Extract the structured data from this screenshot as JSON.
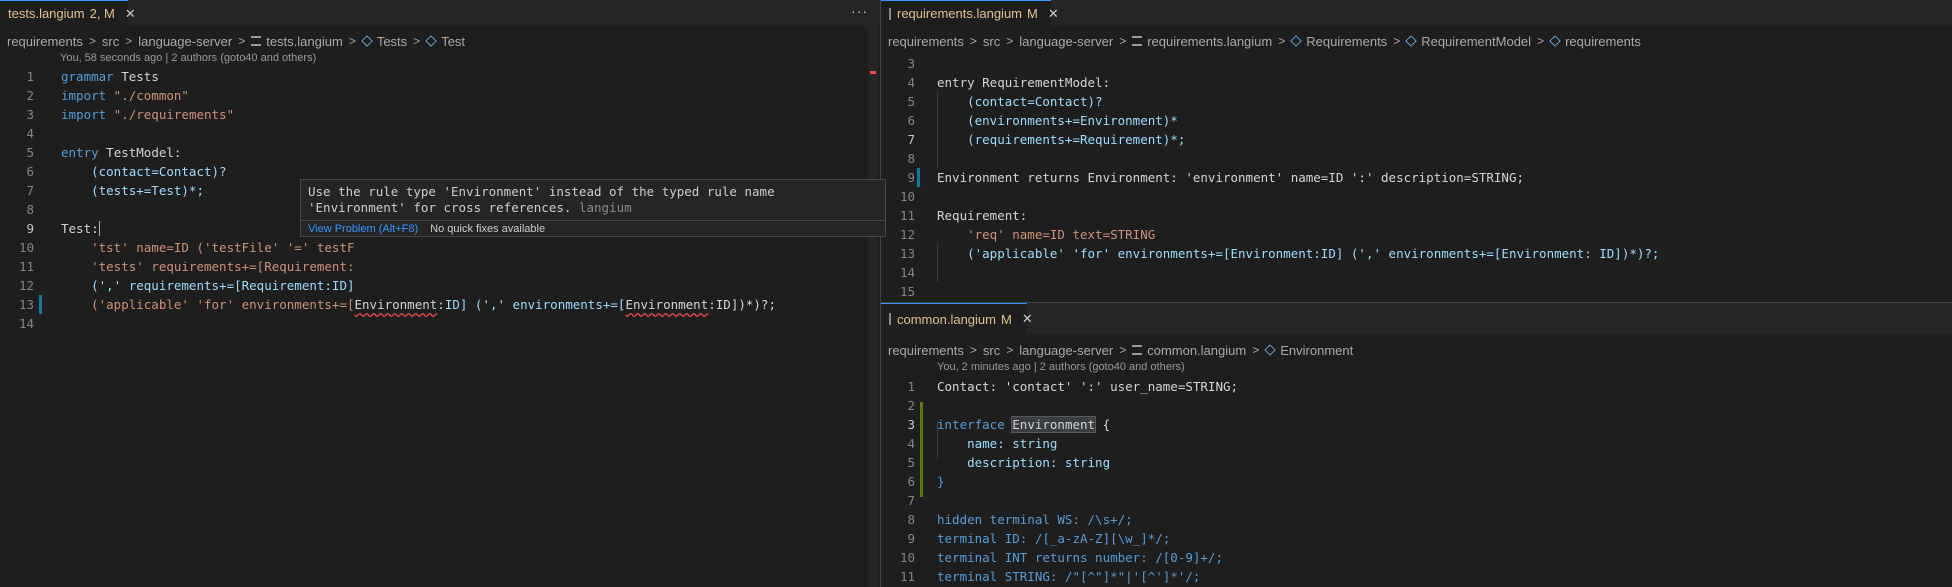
{
  "left": {
    "tab": {
      "name": "tests.langium",
      "status": "2, M"
    },
    "more_label": "···",
    "breadcrumb": [
      "requirements",
      "src",
      "language-server",
      "tests.langium",
      "Tests",
      "Test"
    ],
    "codelens": "You, 58 seconds ago | 2 authors (goto40 and others)",
    "lines": [
      {
        "n": "1"
      },
      {
        "n": "2"
      },
      {
        "n": "3"
      },
      {
        "n": "4"
      },
      {
        "n": "5"
      },
      {
        "n": "6"
      },
      {
        "n": "7"
      },
      {
        "n": "8"
      },
      {
        "n": "9"
      },
      {
        "n": "10"
      },
      {
        "n": "11"
      },
      {
        "n": "12"
      },
      {
        "n": "13"
      },
      {
        "n": "14"
      }
    ],
    "code": {
      "l1_kw": "grammar",
      "l1_name": " Tests",
      "l2_kw": "import",
      "l2_str": " \"./common\"",
      "l3_kw": "import",
      "l3_str": " \"./requirements\"",
      "l5_kw": "entry",
      "l5_rest": " TestModel:",
      "l6": "    (contact=Contact)?",
      "l7": "    (tests+=Test)*;",
      "l9": "Test:",
      "l10": "    'tst' name=ID ('testFile' '=' testF",
      "l11": "    'tests' requirements+=[Requirement:",
      "l12": "    (',' requirements+=[Requirement:ID]",
      "l13a": "    ('applicable' 'for' environments+=[",
      "l13b": "Environment",
      "l13c": ":ID] (',' environments+=[",
      "l13d": "Environment",
      "l13e": ":ID])*)?;"
    },
    "hover": {
      "message": "Use the rule type 'Environment' instead of the typed rule name 'Environment' for cross references.",
      "source": "langium",
      "action": "View Problem (Alt+F8)",
      "nofix": "No quick fixes available"
    }
  },
  "right_top": {
    "tab": {
      "name": "requirements.langium",
      "status": "M"
    },
    "breadcrumb": [
      "requirements",
      "src",
      "language-server",
      "requirements.langium",
      "Requirements",
      "RequirementModel",
      "requirements"
    ],
    "lines": [
      "3",
      "4",
      "5",
      "6",
      "7",
      "8",
      "9",
      "10",
      "11",
      "12",
      "13",
      "14",
      "15"
    ],
    "code": {
      "l4": "entry RequirementModel:",
      "l5": "    (contact=Contact)?",
      "l6": "    (environments+=Environment)*",
      "l7": "    (requirements+=Requirement)*;",
      "l9": "Environment returns Environment: 'environment' name=ID ':' description=STRING;",
      "l11": "Requirement:",
      "l12": "    'req' name=ID text=STRING",
      "l13": "    ('applicable' 'for' environments+=[Environment:ID] (',' environments+=[Environment: ID])*)?;"
    }
  },
  "right_bottom": {
    "tab": {
      "name": "common.langium",
      "status": "M"
    },
    "breadcrumb": [
      "requirements",
      "src",
      "language-server",
      "common.langium",
      "Environment"
    ],
    "codelens": "You, 2 minutes ago | 2 authors (goto40 and others)",
    "lines": [
      "1",
      "2",
      "3",
      "4",
      "5",
      "6",
      "7",
      "8",
      "9",
      "10",
      "11"
    ],
    "code": {
      "l1": "Contact: 'contact' ':' user_name=STRING;",
      "l3a": "interface ",
      "l3b": "Environment",
      "l3c": " {",
      "l4": "    name: string",
      "l5": "    description: string",
      "l6": "}",
      "l8": "hidden terminal WS: /\\s+/;",
      "l9": "terminal ID: /[_a-zA-Z][\\w_]*/;",
      "l10": "terminal INT returns number: /[0-9]+/;",
      "l11": "terminal STRING: /\"[^\"]*\"|'[^']*'/;"
    }
  }
}
